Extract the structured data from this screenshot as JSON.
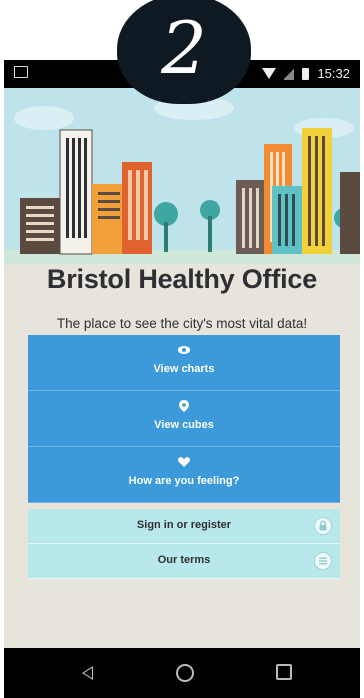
{
  "step_badge": "2",
  "status_bar": {
    "time": "15:32"
  },
  "app": {
    "title": "Bristol Healthy Office",
    "subtitle": "The place to see the city's most vital data!"
  },
  "menu": [
    {
      "label": "View charts",
      "icon": "eye-icon"
    },
    {
      "label": "View cubes",
      "icon": "map-pin-icon"
    },
    {
      "label": "How are you feeling?",
      "icon": "heart-icon"
    }
  ],
  "secondary": [
    {
      "label": "Sign in or register",
      "icon": "lock-icon"
    },
    {
      "label": "Our terms",
      "icon": "document-icon"
    }
  ],
  "colors": {
    "primary_button": "#3c99da",
    "secondary_button": "#b9e8ec",
    "sky": "#bfe3ea",
    "background": "#e7e4dc"
  }
}
